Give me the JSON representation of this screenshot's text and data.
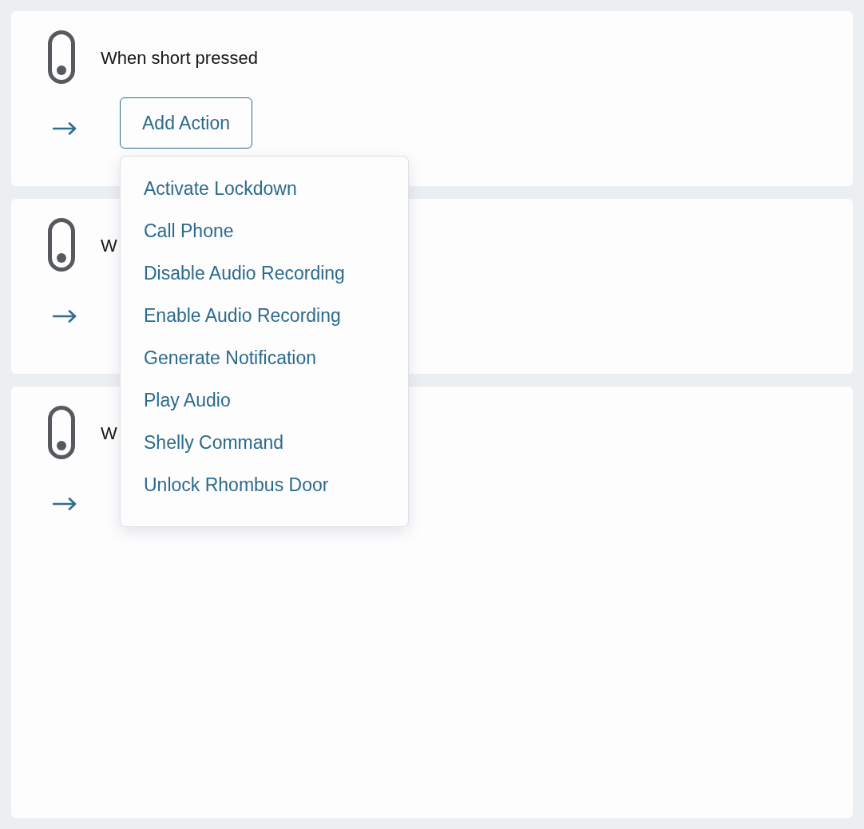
{
  "cards": [
    {
      "trigger": "When short pressed",
      "add_button": "Add Action",
      "menu": {
        "items": [
          "Activate Lockdown",
          "Call Phone",
          "Disable Audio Recording",
          "Enable Audio Recording",
          "Generate Notification",
          "Play Audio",
          "Shelly Command",
          "Unlock Rhombus Door"
        ]
      }
    },
    {
      "trigger": "W"
    },
    {
      "trigger": "W"
    }
  ]
}
